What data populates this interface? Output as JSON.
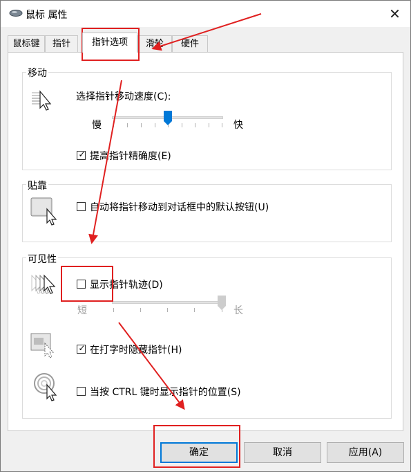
{
  "window": {
    "title": "鼠标 属性"
  },
  "tabs": [
    {
      "label": "鼠标键"
    },
    {
      "label": "指针"
    },
    {
      "label": "指针选项"
    },
    {
      "label": "滑轮"
    },
    {
      "label": "硬件"
    }
  ],
  "motion": {
    "title": "移动",
    "speed_label": "选择指针移动速度(C):",
    "slow_label": "慢",
    "fast_label": "快",
    "speed_level": 0.5,
    "precision_label": "提高指针精确度(E)",
    "precision_checked": true
  },
  "snap": {
    "title": "贴靠",
    "snap_label": "自动将指针移动到对话框中的默认按钮(U)",
    "snap_checked": false
  },
  "visibility": {
    "title": "可见性",
    "trails_label": "显示指针轨迹(D)",
    "trails_checked": false,
    "short_label": "短",
    "long_label": "长",
    "trail_length_level": 1.0,
    "hide_label": "在打字时隐藏指针(H)",
    "hide_checked": true,
    "ctrl_label": "当按 CTRL 键时显示指针的位置(S)",
    "ctrl_checked": false
  },
  "buttons": {
    "ok": "确定",
    "cancel": "取消",
    "apply": "应用(A)"
  },
  "colors": {
    "accent": "#0078d7",
    "annotation": "#e02020"
  },
  "icons": {
    "check": "✓",
    "close": "✕"
  }
}
